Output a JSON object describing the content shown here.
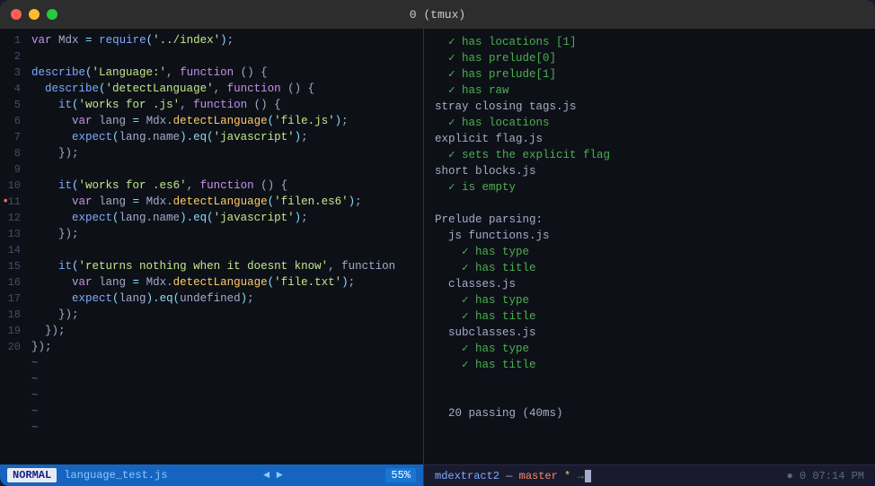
{
  "window": {
    "title": "0 (tmux)"
  },
  "statusbar": {
    "mode": "NORMAL",
    "filename": "language_test.js",
    "arrows": "◄ ►",
    "scroll_pct": "55%"
  },
  "code": {
    "lines": [
      {
        "num": 1,
        "tokens": [
          {
            "t": "kw",
            "v": "var"
          },
          {
            "t": "plain",
            "v": " Mdx "
          },
          {
            "t": "op",
            "v": "="
          },
          {
            "t": "plain",
            "v": " "
          },
          {
            "t": "fn-call",
            "v": "require"
          },
          {
            "t": "paren",
            "v": "("
          },
          {
            "t": "str",
            "v": "'../index'"
          },
          {
            "t": "paren",
            "v": ")"
          },
          {
            "t": "plain",
            "v": ";"
          }
        ]
      },
      {
        "num": 2,
        "tokens": []
      },
      {
        "num": 3,
        "tokens": [
          {
            "t": "fn-call",
            "v": "describe"
          },
          {
            "t": "paren",
            "v": "("
          },
          {
            "t": "str",
            "v": "'Language:'"
          },
          {
            "t": "plain",
            "v": ", "
          },
          {
            "t": "kw",
            "v": "function"
          },
          {
            "t": "plain",
            "v": " () {"
          }
        ]
      },
      {
        "num": 4,
        "tokens": [
          {
            "t": "plain",
            "v": "  "
          },
          {
            "t": "fn-call",
            "v": "describe"
          },
          {
            "t": "paren",
            "v": "("
          },
          {
            "t": "str",
            "v": "'detectLanguage'"
          },
          {
            "t": "plain",
            "v": ", "
          },
          {
            "t": "kw",
            "v": "function"
          },
          {
            "t": "plain",
            "v": " () {"
          }
        ]
      },
      {
        "num": 5,
        "tokens": [
          {
            "t": "plain",
            "v": "    "
          },
          {
            "t": "fn-call",
            "v": "it"
          },
          {
            "t": "paren",
            "v": "("
          },
          {
            "t": "str",
            "v": "'works for .js'"
          },
          {
            "t": "plain",
            "v": ", "
          },
          {
            "t": "kw",
            "v": "function"
          },
          {
            "t": "plain",
            "v": " () {"
          }
        ]
      },
      {
        "num": 6,
        "tokens": [
          {
            "t": "plain",
            "v": "      "
          },
          {
            "t": "kw",
            "v": "var"
          },
          {
            "t": "plain",
            "v": " lang "
          },
          {
            "t": "op",
            "v": "="
          },
          {
            "t": "plain",
            "v": " Mdx."
          },
          {
            "t": "method",
            "v": "detectLanguage"
          },
          {
            "t": "paren",
            "v": "("
          },
          {
            "t": "str",
            "v": "'file.js'"
          },
          {
            "t": "paren",
            "v": ")"
          },
          {
            "t": "plain",
            "v": ";"
          }
        ]
      },
      {
        "num": 7,
        "tokens": [
          {
            "t": "plain",
            "v": "      "
          },
          {
            "t": "fn-call",
            "v": "expect"
          },
          {
            "t": "paren",
            "v": "("
          },
          {
            "t": "plain",
            "v": "lang.name"
          },
          {
            "t": "paren",
            "v": ")"
          },
          {
            "t": "chain",
            "v": ".eq"
          },
          {
            "t": "paren",
            "v": "("
          },
          {
            "t": "str",
            "v": "'javascript'"
          },
          {
            "t": "paren",
            "v": ")"
          },
          {
            "t": "plain",
            "v": ";"
          }
        ]
      },
      {
        "num": 8,
        "tokens": [
          {
            "t": "plain",
            "v": "    });"
          }
        ]
      },
      {
        "num": 9,
        "tokens": []
      },
      {
        "num": 10,
        "tokens": [
          {
            "t": "plain",
            "v": "    "
          },
          {
            "t": "fn-call",
            "v": "it"
          },
          {
            "t": "paren",
            "v": "("
          },
          {
            "t": "str",
            "v": "'works for .es6'"
          },
          {
            "t": "plain",
            "v": ", "
          },
          {
            "t": "kw",
            "v": "function"
          },
          {
            "t": "plain",
            "v": " () {"
          }
        ]
      },
      {
        "num": 11,
        "tokens": [
          {
            "t": "plain",
            "v": "      "
          },
          {
            "t": "kw",
            "v": "var"
          },
          {
            "t": "plain",
            "v": " lang "
          },
          {
            "t": "op",
            "v": "="
          },
          {
            "t": "plain",
            "v": " Mdx."
          },
          {
            "t": "method",
            "v": "detectLanguage"
          },
          {
            "t": "paren",
            "v": "("
          },
          {
            "t": "str",
            "v": "'filen.es6'"
          },
          {
            "t": "paren",
            "v": ")"
          },
          {
            "t": "plain",
            "v": ";"
          }
        ],
        "dot": true
      },
      {
        "num": 12,
        "tokens": [
          {
            "t": "plain",
            "v": "      "
          },
          {
            "t": "fn-call",
            "v": "expect"
          },
          {
            "t": "paren",
            "v": "("
          },
          {
            "t": "plain",
            "v": "lang.name"
          },
          {
            "t": "paren",
            "v": ")"
          },
          {
            "t": "chain",
            "v": ".eq"
          },
          {
            "t": "paren",
            "v": "("
          },
          {
            "t": "str",
            "v": "'javascript'"
          },
          {
            "t": "paren",
            "v": ")"
          },
          {
            "t": "plain",
            "v": ";"
          }
        ]
      },
      {
        "num": 13,
        "tokens": [
          {
            "t": "plain",
            "v": "    });"
          }
        ]
      },
      {
        "num": 14,
        "tokens": []
      },
      {
        "num": 15,
        "tokens": [
          {
            "t": "plain",
            "v": "    "
          },
          {
            "t": "fn-call",
            "v": "it"
          },
          {
            "t": "paren",
            "v": "("
          },
          {
            "t": "str",
            "v": "'returns nothing when it doesnt know'"
          },
          {
            "t": "plain",
            "v": ", function"
          }
        ]
      },
      {
        "num": 16,
        "tokens": [
          {
            "t": "plain",
            "v": "      "
          },
          {
            "t": "kw",
            "v": "var"
          },
          {
            "t": "plain",
            "v": " lang "
          },
          {
            "t": "op",
            "v": "="
          },
          {
            "t": "plain",
            "v": " Mdx."
          },
          {
            "t": "method",
            "v": "detectLanguage"
          },
          {
            "t": "paren",
            "v": "("
          },
          {
            "t": "str",
            "v": "'file.txt'"
          },
          {
            "t": "paren",
            "v": ")"
          },
          {
            "t": "plain",
            "v": ";"
          }
        ]
      },
      {
        "num": 17,
        "tokens": [
          {
            "t": "plain",
            "v": "      "
          },
          {
            "t": "fn-call",
            "v": "expect"
          },
          {
            "t": "paren",
            "v": "("
          },
          {
            "t": "plain",
            "v": "lang"
          },
          {
            "t": "paren",
            "v": ")"
          },
          {
            "t": "chain",
            "v": ".eq"
          },
          {
            "t": "paren",
            "v": "("
          },
          {
            "t": "plain",
            "v": "undefined"
          },
          {
            "t": "paren",
            "v": ")"
          },
          {
            "t": "plain",
            "v": ";"
          }
        ]
      },
      {
        "num": 18,
        "tokens": [
          {
            "t": "plain",
            "v": "    });"
          }
        ]
      },
      {
        "num": 19,
        "tokens": [
          {
            "t": "plain",
            "v": "  });"
          }
        ]
      },
      {
        "num": 20,
        "tokens": [
          {
            "t": "plain",
            "v": "});"
          }
        ]
      }
    ]
  },
  "output": {
    "lines": [
      {
        "cls": "out-pass",
        "indent": 0,
        "v": "  ✓ has locations [1]"
      },
      {
        "cls": "out-pass",
        "indent": 0,
        "v": "  ✓ has prelude[0]"
      },
      {
        "cls": "out-pass",
        "indent": 0,
        "v": "  ✓ has prelude[1]"
      },
      {
        "cls": "out-pass",
        "indent": 0,
        "v": "  ✓ has raw"
      },
      {
        "cls": "out-plain",
        "indent": 0,
        "v": "stray closing tags.js"
      },
      {
        "cls": "out-pass",
        "indent": 0,
        "v": "  ✓ has locations"
      },
      {
        "cls": "out-plain",
        "indent": 0,
        "v": "explicit flag.js"
      },
      {
        "cls": "out-pass",
        "indent": 0,
        "v": "  ✓ sets the explicit flag"
      },
      {
        "cls": "out-plain",
        "indent": 0,
        "v": "short blocks.js"
      },
      {
        "cls": "out-pass",
        "indent": 0,
        "v": "  ✓ is empty"
      },
      {
        "cls": "out-plain",
        "indent": 0,
        "v": ""
      },
      {
        "cls": "out-plain",
        "indent": 0,
        "v": "Prelude parsing:"
      },
      {
        "cls": "out-plain",
        "indent": 0,
        "v": "  js functions.js"
      },
      {
        "cls": "out-pass",
        "indent": 0,
        "v": "    ✓ has type"
      },
      {
        "cls": "out-pass",
        "indent": 0,
        "v": "    ✓ has title"
      },
      {
        "cls": "out-plain",
        "indent": 0,
        "v": "  classes.js"
      },
      {
        "cls": "out-pass",
        "indent": 0,
        "v": "    ✓ has type"
      },
      {
        "cls": "out-pass",
        "indent": 0,
        "v": "    ✓ has title"
      },
      {
        "cls": "out-plain",
        "indent": 0,
        "v": "  subclasses.js"
      },
      {
        "cls": "out-pass",
        "indent": 0,
        "v": "    ✓ has type"
      },
      {
        "cls": "out-pass",
        "indent": 0,
        "v": "    ✓ has title"
      },
      {
        "cls": "out-plain",
        "indent": 0,
        "v": ""
      },
      {
        "cls": "out-plain",
        "indent": 0,
        "v": ""
      },
      {
        "cls": "out-plain",
        "indent": 0,
        "v": "  20 passing (40ms)"
      }
    ],
    "passing_count": "20 passing",
    "passing_time": "(40ms)"
  },
  "shell": {
    "dir": "mdextract2",
    "separator": " — ",
    "branch": "master",
    "star": "*",
    "arrow": "↑",
    "dot": "•",
    "time": "0 07:14 PM"
  }
}
